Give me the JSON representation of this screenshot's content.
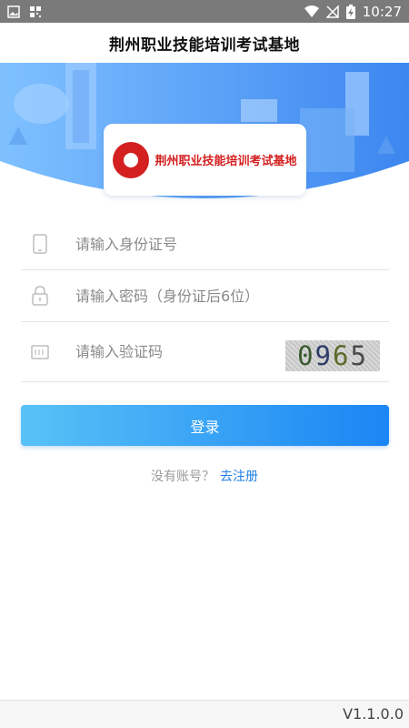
{
  "status_bar": {
    "time": "10:27",
    "battery_icon": "battery-charging-icon",
    "wifi_icon": "wifi-icon",
    "signal_icon": "no-signal-icon"
  },
  "header": {
    "title": "荆州职业技能培训考试基地"
  },
  "banner": {
    "logo_text": "荆州职业技能培训考试基地",
    "logo_icon": "seal-logo-icon"
  },
  "form": {
    "id_placeholder": "请输入身份证号",
    "password_placeholder": "请输入密码（身份证后6位）",
    "captcha_placeholder": "请输入验证码",
    "captcha_code": [
      "0",
      "9",
      "6",
      "5"
    ],
    "login_label": "登录"
  },
  "register": {
    "question": "没有账号？",
    "link": "去注册"
  },
  "footer": {
    "version": "V1.1.0.0"
  },
  "colors": {
    "accent": "#1b85f4",
    "accent_light": "#58c2f7",
    "link": "#1f7fe6"
  }
}
